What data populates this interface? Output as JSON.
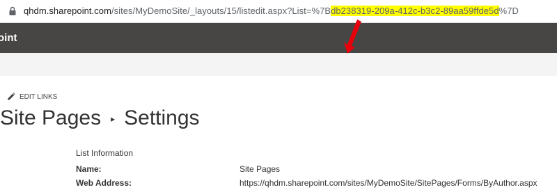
{
  "browser": {
    "url_domain": "qhdm.sharepoint.com",
    "url_path_before": "/sites/MyDemoSite/_layouts/15/listedit.aspx?List=%7B",
    "url_highlight": "db238319-209a-412c-b3c2-89aa59ffde5d",
    "url_after": "%7D",
    "highlight_color": "#ffff00",
    "annotation_color": "#e8000b"
  },
  "suite_bar": {
    "title": "oint",
    "background": "#474644"
  },
  "edit_links": {
    "icon": "pencil-icon",
    "label": "EDIT LINKS"
  },
  "breadcrumb": {
    "parent": "Site Pages",
    "separator": "▸",
    "current": "Settings"
  },
  "list_information": {
    "heading": "List Information",
    "rows": [
      {
        "label": "Name:",
        "value": "Site Pages"
      },
      {
        "label": "Web Address:",
        "value": "https://qhdm.sharepoint.com/sites/MyDemoSite/SitePages/Forms/ByAuthor.aspx"
      }
    ]
  }
}
